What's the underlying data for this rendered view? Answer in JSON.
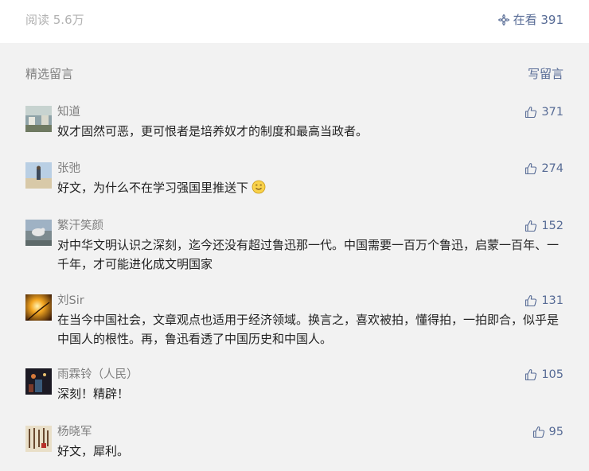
{
  "top": {
    "read_count": "阅读 5.6万",
    "watching_label": "在看 391"
  },
  "section": {
    "title": "精选留言",
    "write_label": "写留言"
  },
  "comments": [
    {
      "name": "知道",
      "text": "奴才固然可恶，更可恨者是培养奴才的制度和最高当政者。",
      "likes": "371"
    },
    {
      "name": "张弛",
      "text": "好文，为什么不在学习强国里推送下",
      "likes": "274",
      "emoji": "smile-emoji"
    },
    {
      "name": "繁汗笑颜",
      "text": "对中华文明认识之深刻，迄今还没有超过鲁迅那一代。中国需要一百万个鲁迅，启蒙一百年、一千年，才可能进化成文明国家",
      "likes": "152"
    },
    {
      "name": "刘Sir",
      "text": "在当今中国社会，文章观点也适用于经济领域。换言之，喜欢被拍，懂得拍，一拍即合，似乎是中国人的根性。再，鲁迅看透了中国历史和中国人。",
      "likes": "131"
    },
    {
      "name": "雨霖铃（人民）",
      "text": "深刻！精辟！",
      "likes": "105"
    },
    {
      "name": "杨晓军",
      "text": "好文，犀利。",
      "likes": "95"
    }
  ],
  "colors": {
    "link": "#576b95",
    "muted": "#7f7f7f",
    "text": "#222222",
    "background": "#f2f2f2"
  }
}
